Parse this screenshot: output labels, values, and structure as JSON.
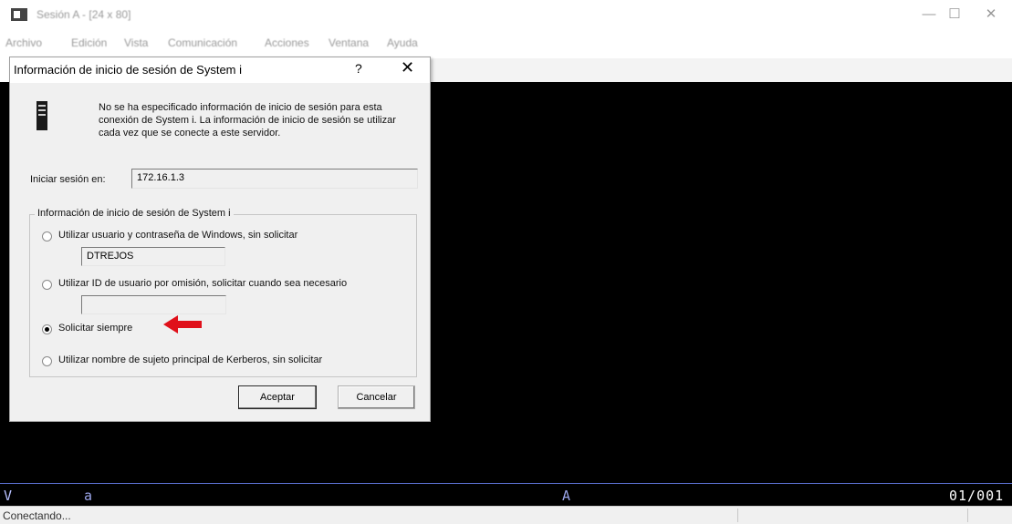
{
  "window": {
    "title": "Sesión A - [24 x 80]",
    "minimize_glyph": "—",
    "maximize_glyph": "☐",
    "close_glyph": "✕"
  },
  "menubar": [
    "Archivo",
    "Edición",
    "Vista",
    "Comunicación",
    "Acciones",
    "Ventana",
    "Ayuda"
  ],
  "dialog": {
    "title": "Información de inicio de sesión de System i",
    "help_glyph": "?",
    "close_glyph": "✕",
    "icon": "system-i-server-icon",
    "message": "No se ha especificado información de inicio de sesión para esta conexión de System i. La información de inicio de sesión se utilizar cada vez que se conecte a este servidor.",
    "host_label": "Iniciar sesión en:",
    "host_value": "172.16.1.3",
    "group_label": "Información de inicio de sesión de System i",
    "options": [
      {
        "label": "Utilizar usuario y contraseña de Windows, sin solicitar",
        "selected": false,
        "field_value": "DTREJOS"
      },
      {
        "label": "Utilizar ID de usuario por omisión, solicitar cuando sea necesario",
        "selected": false,
        "field_value": ""
      },
      {
        "label": "Solicitar siempre",
        "selected": true
      },
      {
        "label": "Utilizar nombre de sujeto principal de Kerberos, sin solicitar",
        "selected": false
      }
    ],
    "ok_label": "Aceptar",
    "cancel_label": "Cancelar",
    "annotation_color": "#e0101a"
  },
  "status": {
    "left_mark": "V",
    "indicator_a": "a",
    "indicator_A": "A",
    "cursor_position": "01/001",
    "connection": "Conectando..."
  },
  "colors": {
    "terminal_bg": "#000000",
    "status_line": "#5a6fd0"
  }
}
